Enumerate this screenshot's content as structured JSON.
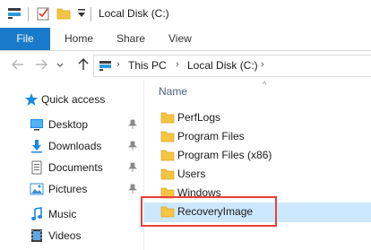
{
  "window": {
    "title": "Local Disk (C:)"
  },
  "ribbon": {
    "tabs": [
      {
        "label": "File",
        "active": true
      },
      {
        "label": "Home"
      },
      {
        "label": "Share"
      },
      {
        "label": "View"
      }
    ]
  },
  "address": {
    "segments": [
      "This PC",
      "Local Disk (C:)"
    ]
  },
  "navpane": {
    "items": [
      {
        "label": "Quick access",
        "icon": "star-icon"
      },
      {
        "label": "Desktop",
        "icon": "desktop-icon",
        "pinned": true
      },
      {
        "label": "Downloads",
        "icon": "download-icon",
        "pinned": true
      },
      {
        "label": "Documents",
        "icon": "documents-icon",
        "pinned": true
      },
      {
        "label": "Pictures",
        "icon": "pictures-icon",
        "pinned": true
      },
      {
        "label": "Music",
        "icon": "music-icon"
      },
      {
        "label": "Videos",
        "icon": "videos-icon"
      }
    ]
  },
  "filelist": {
    "column_header": "Name",
    "items": [
      {
        "name": "PerfLogs"
      },
      {
        "name": "Program Files"
      },
      {
        "name": "Program Files (x86)"
      },
      {
        "name": "Users"
      },
      {
        "name": "Windows"
      },
      {
        "name": "RecoveryImage",
        "selected": true
      }
    ]
  },
  "colors": {
    "accent": "#1979ca",
    "selection": "#cce8ff",
    "highlight": "#e8403a",
    "folder": "#f5c542"
  }
}
